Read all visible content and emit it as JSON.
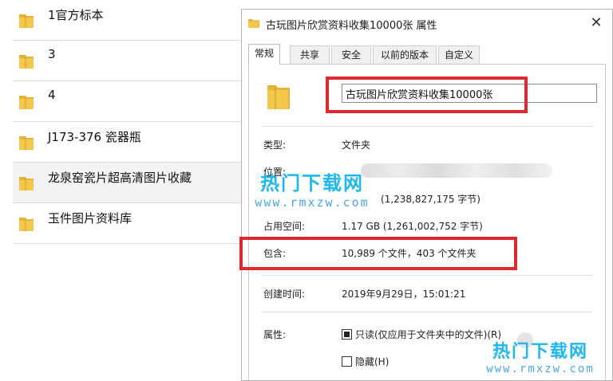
{
  "folder_list": {
    "items": [
      {
        "name": "1官方标本",
        "selected": false
      },
      {
        "name": "3",
        "selected": false
      },
      {
        "name": "4",
        "selected": false
      },
      {
        "name": "J173-376 瓷器瓶",
        "selected": false
      },
      {
        "name": "龙泉窑瓷片超高清图片收藏",
        "selected": true
      },
      {
        "name": "玉件图片资料库",
        "selected": false
      }
    ]
  },
  "dialog": {
    "title": "古玩图片欣赏资料收集10000张 属性",
    "close_glyph": "✕",
    "tabs": [
      {
        "label": "常规",
        "active": true
      },
      {
        "label": "共享",
        "active": false
      },
      {
        "label": "安全",
        "active": false
      },
      {
        "label": "以前的版本",
        "active": false
      },
      {
        "label": "自定义",
        "active": false
      }
    ],
    "name_value": "古玩图片欣赏资料收集10000张",
    "fields": {
      "type_label": "类型:",
      "type_value": "文件夹",
      "location_label": "位置:",
      "size_value": "(1,238,827,175 字节)",
      "disk_size_label": "占用空间:",
      "disk_size_value": "1.17 GB (1,261,002,752 字节)",
      "contains_label": "包含:",
      "contains_value": "10,989 个文件，403 个文件夹",
      "created_label": "创建时间:",
      "created_value": "2019年9月29日，15:01:21",
      "attributes_label": "属性:",
      "readonly_label": "只读(仅应用于文件夹中的文件)(R)",
      "hidden_label": "隐藏(H)"
    }
  },
  "watermark": {
    "cn": "热门下载网",
    "en": "www.rmxzw.com"
  },
  "colors": {
    "highlight": "#e0292e",
    "folder_yellow": "#f3c94d",
    "watermark_blue": "#1fb7f0"
  },
  "icons": [
    "folder-icon",
    "close-icon",
    "checkbox-indeterminate",
    "checkbox-empty"
  ]
}
